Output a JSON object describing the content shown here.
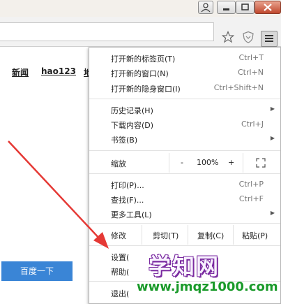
{
  "nav_links": [
    "新闻",
    "hao123",
    "地"
  ],
  "search_button": "百度一下",
  "menu": {
    "items": [
      {
        "label": "打开新的标签页(T)",
        "shortcut": "Ctrl+T"
      },
      {
        "label": "打开新的窗口(N)",
        "shortcut": "Ctrl+N"
      },
      {
        "label": "打开新的隐身窗口(I)",
        "shortcut": "Ctrl+Shift+N"
      },
      {
        "label": "历史记录(H)",
        "shortcut": ""
      },
      {
        "label": "下载内容(D)",
        "shortcut": "Ctrl+J"
      },
      {
        "label": "书签(B)",
        "shortcut": ""
      },
      {
        "label": "打印(P)...",
        "shortcut": "Ctrl+P"
      },
      {
        "label": "查找(F)...",
        "shortcut": "Ctrl+F"
      },
      {
        "label": "更多工具(L)",
        "shortcut": ""
      },
      {
        "label": "设置(",
        "shortcut": ""
      },
      {
        "label": "帮助(",
        "shortcut": ""
      },
      {
        "label": "退出(",
        "shortcut": ""
      }
    ],
    "zoom": {
      "label": "缩放",
      "minus": "-",
      "value": "100%",
      "plus": "+"
    },
    "edit": {
      "label": "修改",
      "cut": "剪切(T)",
      "copy": "复制(C)",
      "paste": "粘贴(P)"
    }
  },
  "watermark": {
    "title": "学知网",
    "url": "www.jmqz1000.com"
  },
  "colors": {
    "search_button": "#3a85d6",
    "arrow": "#e53935",
    "watermark_url": "#1a9a2a"
  }
}
